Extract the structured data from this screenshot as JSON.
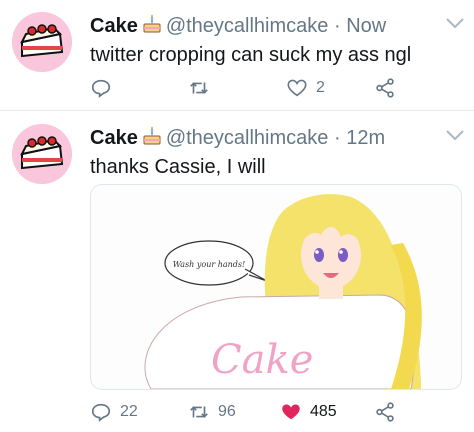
{
  "tweets": [
    {
      "name": "Cake",
      "handle": "@theycallhimcake",
      "separator": "·",
      "time": "Now",
      "text": "twitter cropping can suck my ass ngl",
      "replies": "",
      "retweets": "",
      "likes": "2",
      "liked": false
    },
    {
      "name": "Cake",
      "handle": "@theycallhimcake",
      "separator": "·",
      "time": "12m",
      "text": "thanks Cassie, I will",
      "replies": "22",
      "retweets": "96",
      "likes": "485",
      "liked": true,
      "media": {
        "speech_bubble": "Wash your hands!",
        "shirt_text": "Cake"
      }
    }
  ],
  "colors": {
    "like_active": "#e0245e",
    "secondary_text": "#657786",
    "avatar_bg": "#f9c6dc"
  },
  "icons": [
    "cake-avatar",
    "cake-emoji-icon",
    "chevron-down-icon",
    "reply-icon",
    "retweet-icon",
    "heart-icon",
    "share-icon"
  ]
}
